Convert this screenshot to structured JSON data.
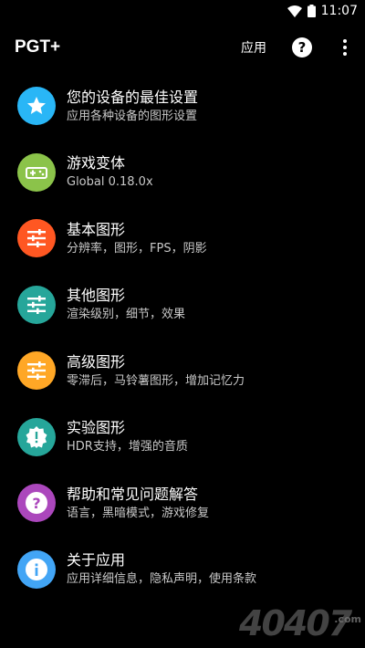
{
  "status_bar": {
    "time": "11:07"
  },
  "app_bar": {
    "title": "PGT+",
    "apply_label": "应用",
    "help_glyph": "?"
  },
  "items": [
    {
      "title": "您的设备的最佳设置",
      "subtitle": "应用各种设备的图形设置",
      "icon": "star-icon",
      "color": "#29b6f6"
    },
    {
      "title": "游戏变体",
      "subtitle": "Global 0.18.0x",
      "icon": "gamepad-icon",
      "color": "#8bc34a"
    },
    {
      "title": "基本图形",
      "subtitle": "分辨率，图形，FPS，阴影",
      "icon": "sliders-icon",
      "color": "#ff5722"
    },
    {
      "title": "其他图形",
      "subtitle": "渲染级别，细节，效果",
      "icon": "sliders-icon",
      "color": "#26a69a"
    },
    {
      "title": "高级图形",
      "subtitle": "零滞后，马铃薯图形，增加记忆力",
      "icon": "sliders-icon",
      "color": "#ffa726"
    },
    {
      "title": "实验图形",
      "subtitle": "HDR支持，增强的音质",
      "icon": "alert-badge-icon",
      "color": "#26a69a"
    },
    {
      "title": "帮助和常见问题解答",
      "subtitle": "语言，黑暗模式，游戏修复",
      "icon": "question-icon",
      "color": "#ab47bc"
    },
    {
      "title": "关于应用",
      "subtitle": "应用详细信息，隐私声明，使用条款",
      "icon": "info-icon",
      "color": "#42a5f5"
    }
  ],
  "watermark": {
    "text": "40407",
    "suffix": ".com"
  }
}
